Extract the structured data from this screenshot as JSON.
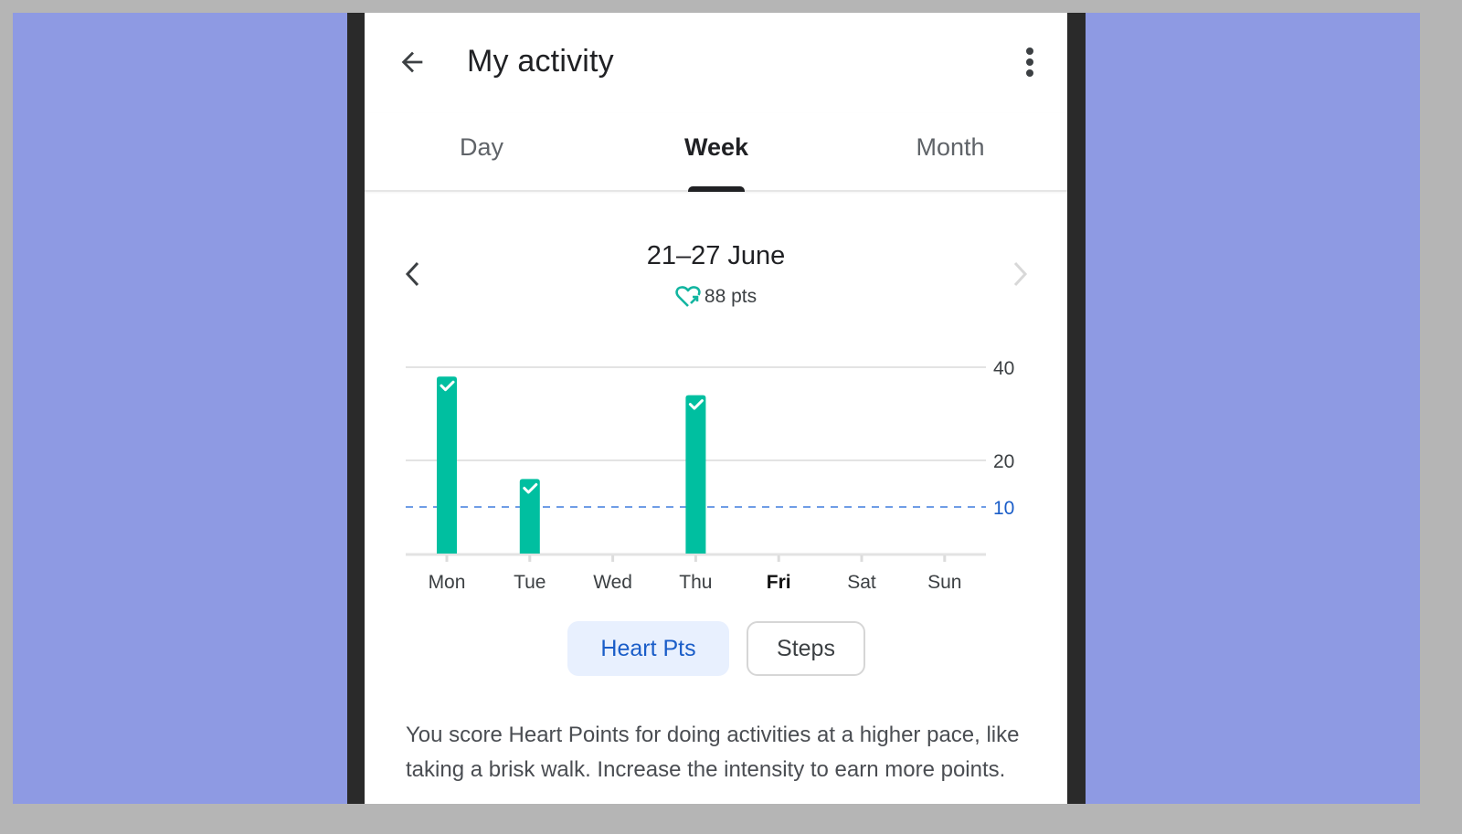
{
  "appbar": {
    "title": "My activity",
    "back_icon": "arrow-left-icon",
    "more_icon": "more-vert-icon"
  },
  "tabs": [
    {
      "label": "Day",
      "active": false
    },
    {
      "label": "Week",
      "active": true
    },
    {
      "label": "Month",
      "active": false
    }
  ],
  "range": {
    "title": "21–27 June",
    "points": "88 pts",
    "points_icon": "heart-points-icon",
    "prev_icon": "chevron-left-icon",
    "next_icon": "chevron-right-icon",
    "next_enabled": false
  },
  "colors": {
    "bar": "#00bfa0",
    "goal_line": "#6f9de6",
    "goal_label": "#1a5dc8",
    "chip_active_bg": "#e8f0fe",
    "chip_active_text": "#1a5dc8"
  },
  "chart_data": {
    "type": "bar",
    "title": "",
    "xlabel": "",
    "ylabel": "Heart Points",
    "categories": [
      "Mon",
      "Tue",
      "Wed",
      "Thu",
      "Fri",
      "Sat",
      "Sun"
    ],
    "values": [
      38,
      16,
      0,
      34,
      0,
      0,
      0
    ],
    "goal_met": [
      true,
      true,
      false,
      true,
      false,
      false,
      false
    ],
    "highlighted_category": "Fri",
    "ylim": [
      0,
      40
    ],
    "yticks": [
      20,
      40
    ],
    "ytick_labels": [
      "20",
      "40"
    ],
    "goal_line": {
      "value": 10,
      "label": "10",
      "style": "dashed"
    },
    "grid": true,
    "axis_side": "right"
  },
  "metric_toggle": {
    "options": [
      {
        "label": "Heart Pts",
        "selected": true
      },
      {
        "label": "Steps",
        "selected": false
      }
    ]
  },
  "description": "You score Heart Points for doing activities at a higher pace, like taking a brisk walk. Increase the intensity to earn more points."
}
